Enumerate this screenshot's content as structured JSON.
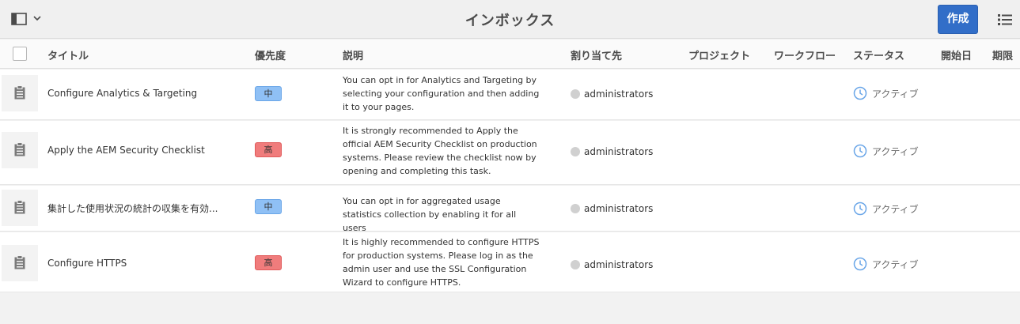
{
  "header": {
    "title": "インボックス",
    "create_label": "作成",
    "rail_toggle_icon": "rail-icon",
    "view_toggle_icon": "list-view-icon"
  },
  "columns": {
    "title": "タイトル",
    "priority": "優先度",
    "description": "説明",
    "assignee": "割り当て先",
    "project": "プロジェクト",
    "workflow": "ワークフロー",
    "status": "ステータス",
    "start_date": "開始日",
    "due_date": "期限"
  },
  "rows": [
    {
      "title": "Configure Analytics & Targeting",
      "priority": "中",
      "priority_level": "mid",
      "description": "You can opt in for Analytics and Targeting by selecting your configuration and then adding it to your pages.",
      "assignee": "administrators",
      "status": "アクティブ"
    },
    {
      "title": "Apply the AEM Security Checklist",
      "priority": "高",
      "priority_level": "high",
      "description": "It is strongly recommended to Apply the official AEM Security Checklist on production systems. Please review the checklist now by opening and completing this task.",
      "assignee": "administrators",
      "status": "アクティブ"
    },
    {
      "title": "集計した使用状況の統計の収集を有効...",
      "priority": "中",
      "priority_level": "mid",
      "description": "You can opt in for aggregated usage statistics collection by enabling it for all users",
      "assignee": "administrators",
      "status": "アクティブ"
    },
    {
      "title": "Configure HTTPS",
      "priority": "高",
      "priority_level": "high",
      "description": "It is highly recommended to configure HTTPS for production systems. Please log in as the admin user and use the SSL Configuration Wizard to configure HTTPS.",
      "assignee": "administrators",
      "status": "アクティブ"
    }
  ],
  "colors": {
    "accent": "#326ec8",
    "priority_mid": "#8fc0f5",
    "priority_high": "#f07c7c",
    "status_icon": "#6aa6e8"
  }
}
